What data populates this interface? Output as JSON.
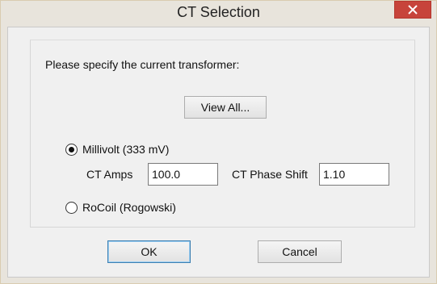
{
  "window": {
    "title": "CT Selection",
    "close_glyph": "×"
  },
  "group": {
    "label": "Please specify the current transformer:"
  },
  "view_all_button": "View All...",
  "options": {
    "millivolt": {
      "label": "Millivolt (333 mV)",
      "selected": true
    },
    "rocoil": {
      "label": "RoCoil (Rogowski)",
      "selected": false
    }
  },
  "ct_amps": {
    "label": "CT Amps",
    "value": "100.0"
  },
  "ct_phase_shift": {
    "label": "CT Phase Shift",
    "value": "1.10"
  },
  "buttons": {
    "ok": "OK",
    "cancel": "Cancel"
  },
  "colors": {
    "close_button": "#c7443b",
    "default_button_border": "#3c7fb1"
  }
}
